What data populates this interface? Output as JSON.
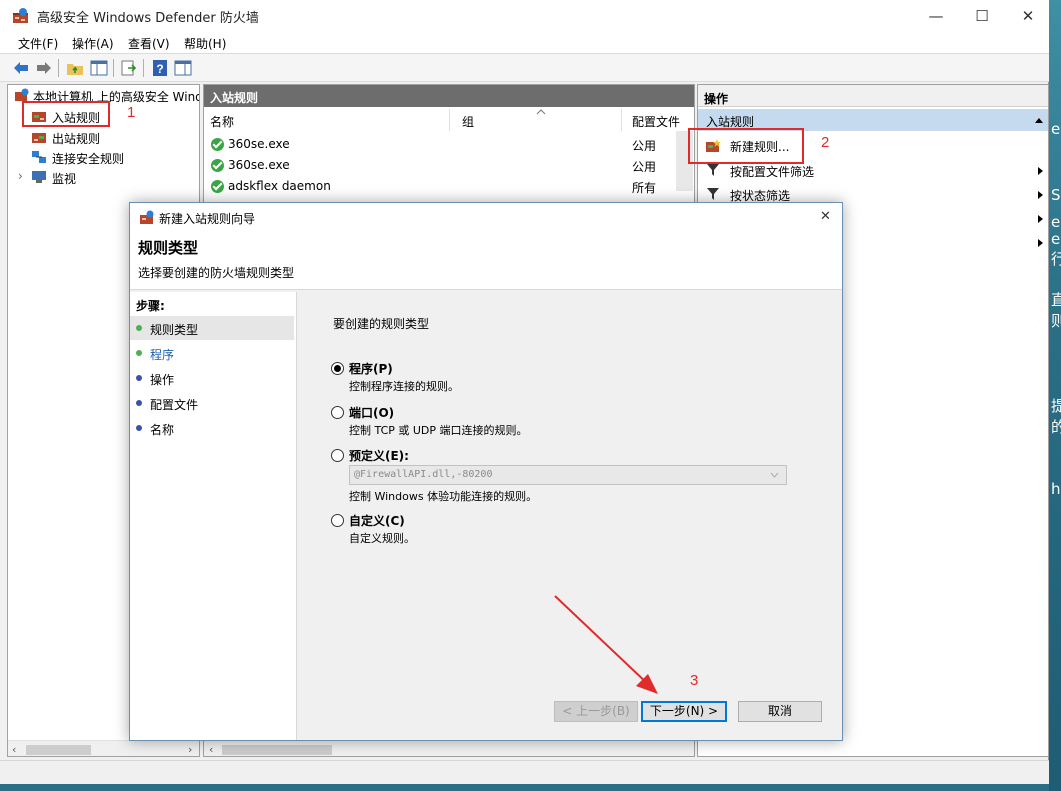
{
  "window": {
    "title": "高级安全 Windows Defender 防火墙",
    "minimize": "—",
    "maximize": "☐",
    "close": "✕"
  },
  "menu": [
    "文件(F)",
    "操作(A)",
    "查看(V)",
    "帮助(H)"
  ],
  "tree": {
    "root": "本地计算机 上的高级安全 Windows Defender 防火墙",
    "items": [
      "入站规则",
      "出站规则",
      "连接安全规则",
      "监视"
    ],
    "expander": "›"
  },
  "center": {
    "header": "入站规则",
    "columns": [
      "名称",
      "组",
      "配置文件"
    ],
    "rows": [
      {
        "name": "360se.exe",
        "group": "",
        "profile": "公用"
      },
      {
        "name": "360se.exe",
        "group": "",
        "profile": "公用"
      },
      {
        "name": "adskflex daemon",
        "group": "",
        "profile": "所有"
      }
    ]
  },
  "actions": {
    "header": "操作",
    "section": "入站规则",
    "items": [
      "新建规则...",
      "按配置文件筛选",
      "按状态筛选"
    ]
  },
  "desktop_text": [
    "e",
    "S",
    "e",
    "e",
    "行",
    "直",
    "则",
    "提",
    "的",
    "h"
  ],
  "dialog": {
    "title": "新建入站规则向导",
    "close": "✕",
    "heading": "规则类型",
    "subheading": "选择要创建的防火墙规则类型",
    "steps_label": "步骤:",
    "steps": [
      "规则类型",
      "程序",
      "操作",
      "配置文件",
      "名称"
    ],
    "body_prompt": "要创建的规则类型",
    "options": [
      {
        "label": "程序(P)",
        "desc": "控制程序连接的规则。",
        "selected": true
      },
      {
        "label": "端口(O)",
        "desc": "控制 TCP 或 UDP 端口连接的规则。",
        "selected": false
      },
      {
        "label": "预定义(E):",
        "desc": "控制 Windows 体验功能连接的规则。",
        "selected": false
      },
      {
        "label": "自定义(C)",
        "desc": "自定义规则。",
        "selected": false
      }
    ],
    "predefined_value": "@FirewallAPI.dll,-80200",
    "buttons": {
      "back": "< 上一步(B)",
      "next": "下一步(N) >",
      "cancel": "取消"
    }
  },
  "annotations": [
    "1",
    "2",
    "3"
  ],
  "colors": {
    "annotation": "#e02b2b",
    "selected_row": "#c5d9ef",
    "pane_header": "#6d6d6d",
    "rule_enabled": "#3aa547"
  }
}
